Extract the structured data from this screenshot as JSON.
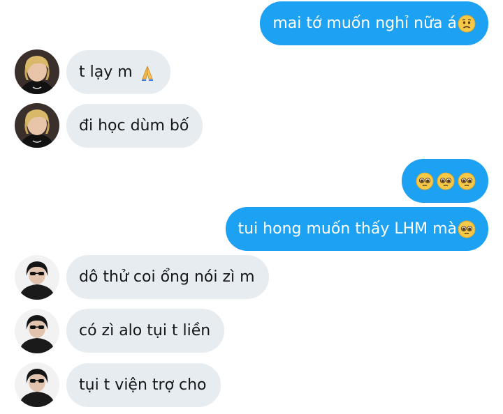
{
  "colors": {
    "outgoing_bubble": "#1da1f2",
    "incoming_bubble": "#e6ecf0",
    "outgoing_text": "#ffffff",
    "incoming_text": "#14171a"
  },
  "messages": [
    {
      "direction": "outgoing",
      "text": "mai tớ muốn nghỉ nữa á",
      "emoji": [
        "worried-face"
      ]
    },
    {
      "direction": "incoming",
      "sender": "blonde-avatar",
      "text": "t lạy m",
      "emoji": [
        "folded-hands"
      ]
    },
    {
      "direction": "incoming",
      "sender": "blonde-avatar",
      "text": "đi học dùm bố",
      "emoji": []
    },
    {
      "direction": "outgoing",
      "text": "",
      "emoji": [
        "pleading-face",
        "pleading-face",
        "pleading-face"
      ]
    },
    {
      "direction": "outgoing",
      "text": "tui hong muốn thấy LHM mà",
      "emoji": [
        "pleading-face"
      ]
    },
    {
      "direction": "incoming",
      "sender": "dark-hair-avatar",
      "text": "dô thử coi ổng nói zì m",
      "emoji": []
    },
    {
      "direction": "incoming",
      "sender": "dark-hair-avatar",
      "text": "có zì alo tụi t liền",
      "emoji": []
    },
    {
      "direction": "incoming",
      "sender": "dark-hair-avatar",
      "text": "tụi t viện trợ cho",
      "emoji": []
    }
  ]
}
